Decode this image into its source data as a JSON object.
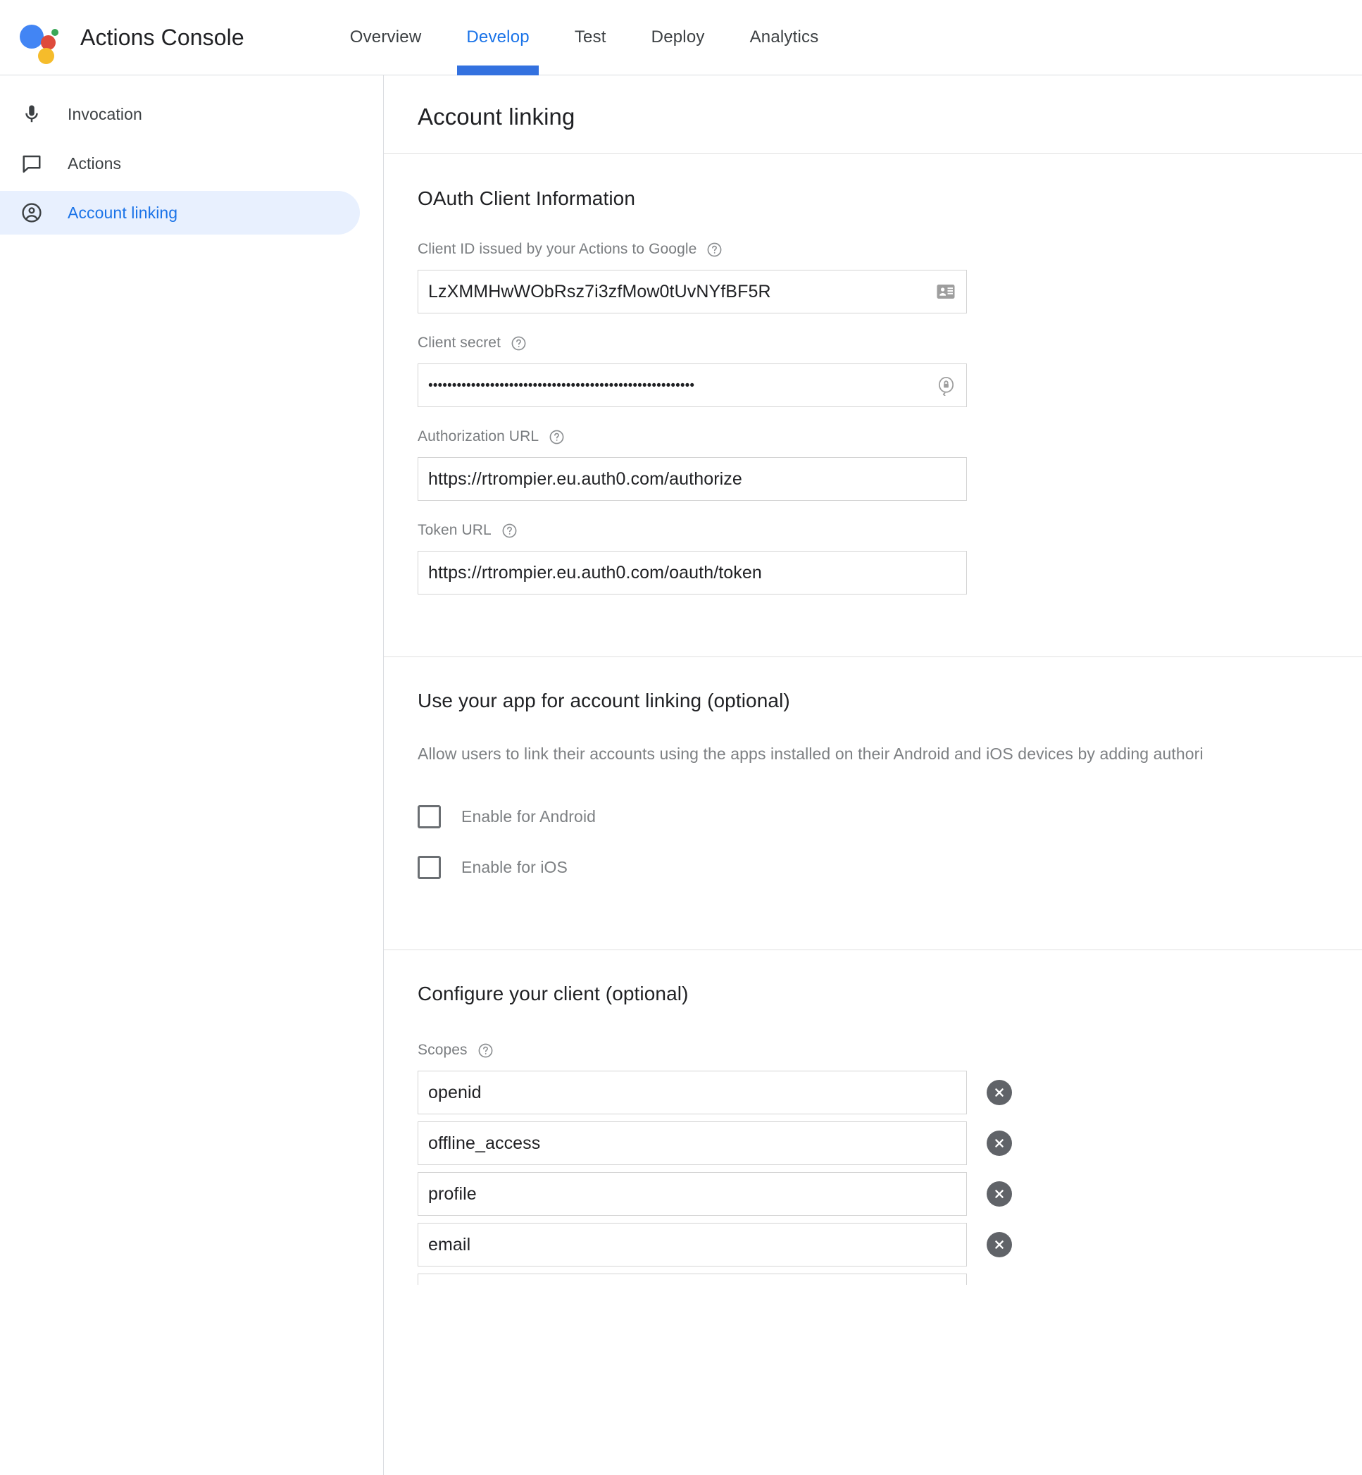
{
  "app": {
    "title": "Actions Console",
    "logo_icon": "google-assistant-logo",
    "logo_colors": {
      "blue": "#4285f4",
      "red": "#de4b3c",
      "yellow": "#f5bc2b",
      "green": "#3aa757"
    },
    "accent_color": "#1a73e8"
  },
  "nav": {
    "tabs": [
      {
        "label": "Overview",
        "active": false
      },
      {
        "label": "Develop",
        "active": true
      },
      {
        "label": "Test",
        "active": false
      },
      {
        "label": "Deploy",
        "active": false
      },
      {
        "label": "Analytics",
        "active": false
      }
    ]
  },
  "sidebar": {
    "items": [
      {
        "label": "Invocation",
        "icon": "microphone-icon",
        "active": false
      },
      {
        "label": "Actions",
        "icon": "chat-bubble-icon",
        "active": false
      },
      {
        "label": "Account linking",
        "icon": "account-circle-icon",
        "active": true
      }
    ]
  },
  "main": {
    "page_title": "Account linking",
    "sections": {
      "oauth": {
        "title": "OAuth Client Information",
        "fields": {
          "client_id": {
            "label": "Client ID issued by your Actions to Google",
            "value": "LzXMMHwWObRsz7i3zfMow0tUvNYfBF5R",
            "trailing_icon": "contact-card-icon",
            "help_icon": "help-circle-icon"
          },
          "client_secret": {
            "label": "Client secret",
            "value": "••••••••••••••••••••••••••••••••••••••••••••••••••••••••",
            "trailing_icon": "lock-reset-icon",
            "help_icon": "help-circle-icon"
          },
          "authorization_url": {
            "label": "Authorization URL",
            "value": "https://rtrompier.eu.auth0.com/authorize",
            "help_icon": "help-circle-icon"
          },
          "token_url": {
            "label": "Token URL",
            "value": "https://rtrompier.eu.auth0.com/oauth/token",
            "help_icon": "help-circle-icon"
          }
        }
      },
      "app_linking": {
        "title": "Use your app for account linking (optional)",
        "description": "Allow users to link their accounts using the apps installed on their Android and iOS devices by adding authori",
        "checkboxes": [
          {
            "label": "Enable for Android",
            "checked": false
          },
          {
            "label": "Enable for iOS",
            "checked": false
          }
        ]
      },
      "configure_client": {
        "title": "Configure your client (optional)",
        "scopes_label": "Scopes",
        "scopes_help_icon": "help-circle-icon",
        "scopes": [
          {
            "value": "openid",
            "delete_icon": "close-circle-icon"
          },
          {
            "value": "offline_access",
            "delete_icon": "close-circle-icon"
          },
          {
            "value": "profile",
            "delete_icon": "close-circle-icon"
          },
          {
            "value": "email",
            "delete_icon": "close-circle-icon"
          }
        ]
      }
    }
  }
}
